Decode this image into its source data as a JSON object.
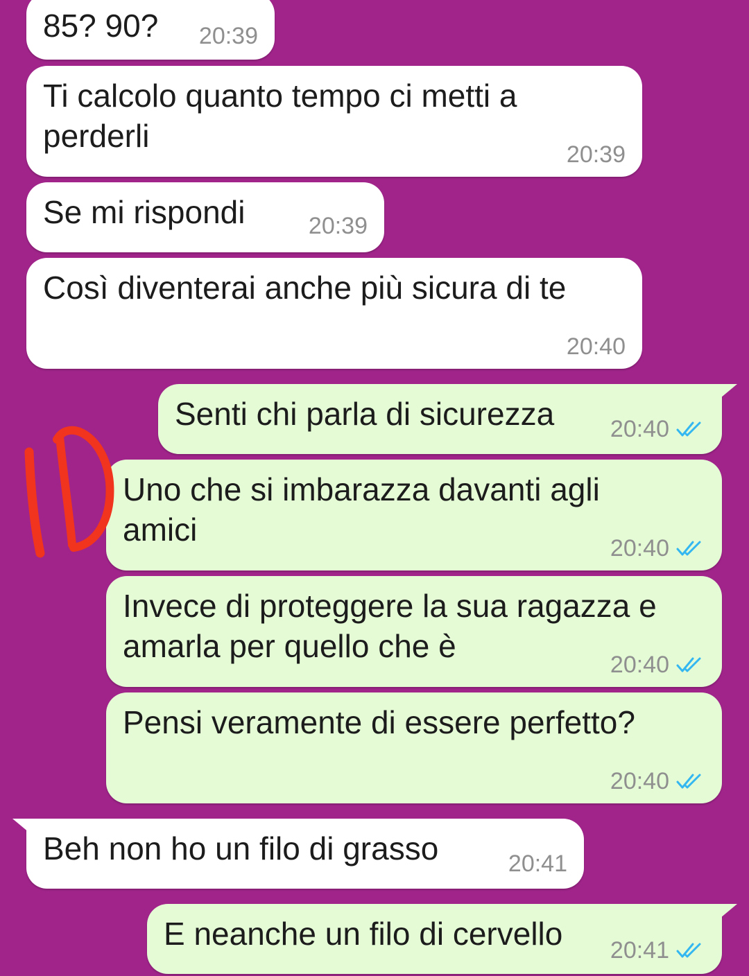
{
  "conversation": {
    "messages": [
      {
        "text": "85? 90?",
        "time": "20:39",
        "direction": "incoming"
      },
      {
        "text": "Ti calcolo quanto tempo ci metti a\nperderli",
        "time": "20:39",
        "direction": "incoming"
      },
      {
        "text": "Se mi rispondi",
        "time": "20:39",
        "direction": "incoming"
      },
      {
        "text": "Così diventerai anche più sicura di te",
        "time": "20:40",
        "direction": "incoming"
      },
      {
        "text": "Senti chi parla di sicurezza",
        "time": "20:40",
        "direction": "outgoing",
        "status_icon": "double-check-read-icon"
      },
      {
        "text": "Uno che si imbarazza davanti agli\namici",
        "time": "20:40",
        "direction": "outgoing",
        "status_icon": "double-check-read-icon"
      },
      {
        "text": "Invece di proteggere la sua ragazza e\namarla per quello che è",
        "time": "20:40",
        "direction": "outgoing",
        "status_icon": "double-check-read-icon"
      },
      {
        "text": "Pensi veramente di essere perfetto?",
        "time": "20:40",
        "direction": "outgoing",
        "status_icon": "double-check-read-icon"
      },
      {
        "text": "Beh non ho un filo di grasso",
        "time": "20:41",
        "direction": "incoming"
      },
      {
        "text": "E neanche un filo di cervello",
        "time": "20:41",
        "direction": "outgoing",
        "status_icon": "double-check-read-icon"
      }
    ]
  },
  "colors": {
    "background": "#a0248a",
    "incoming_bubble": "#ffffff",
    "outgoing_bubble": "#e4fbd6",
    "read_ticks": "#34b7f1",
    "annotation": "#f0341e"
  }
}
